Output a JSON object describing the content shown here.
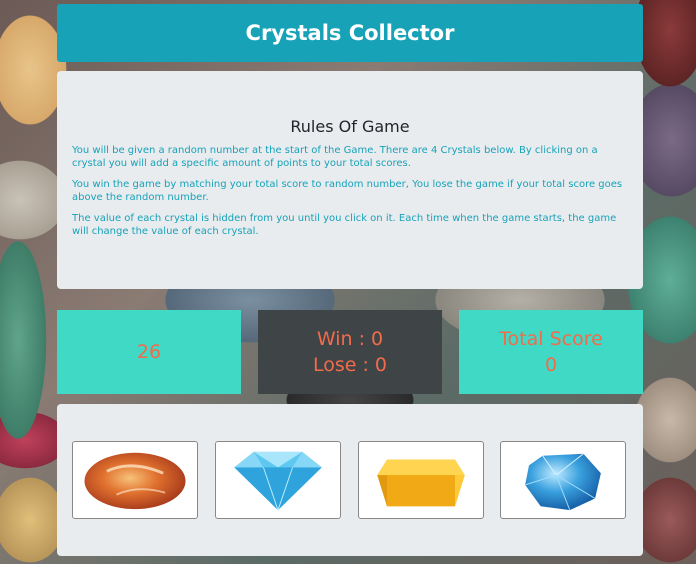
{
  "header": {
    "title": "Crystals Collector"
  },
  "rules": {
    "heading": "Rules Of Game",
    "paragraphs": [
      "You will be given a random number at the start of the Game. There are 4 Crystals below. By clicking on a crystal you will add a specific amount of points to your total scores.",
      "You win the game by matching your total score to random number, You lose the game if your total score goes above the random number.",
      "The value of each crystal is hidden from you until you click on it. Each time when the game starts, the game will change the value of each crystal."
    ]
  },
  "scoreboard": {
    "random_number": "26",
    "win_label": "Win : 0",
    "lose_label": "Lose : 0",
    "total_label": "Total Score",
    "total_value": "0"
  },
  "crystals": [
    {
      "icon": "orange-agate-crystal-icon"
    },
    {
      "icon": "blue-diamond-crystal-icon"
    },
    {
      "icon": "yellow-hexagon-crystal-icon"
    },
    {
      "icon": "aqua-round-crystal-icon"
    }
  ],
  "colors": {
    "accent": "#17a2b8",
    "score_text": "#f26b4a",
    "score_box": "#3fd9c6",
    "winlose_box": "#3f4447",
    "panel": "#e9ecef"
  }
}
